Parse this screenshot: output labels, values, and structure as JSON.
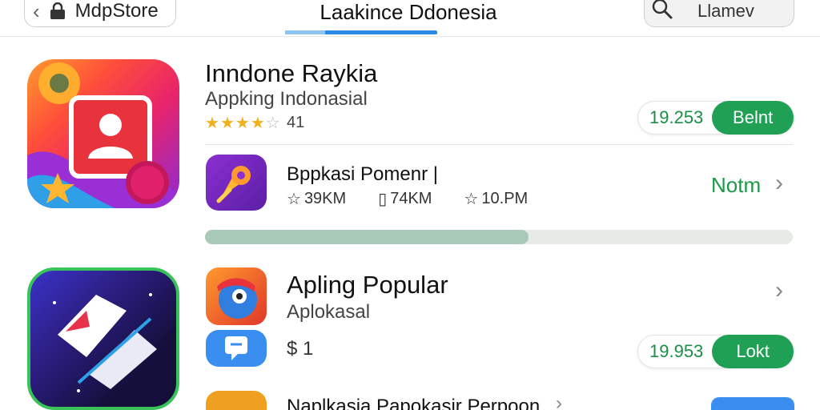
{
  "header": {
    "back_label": "MdpStore",
    "title": "Laakince Ddonesia",
    "search_placeholder": "Llamev"
  },
  "featured": {
    "title": "Inndone Raykia",
    "subtitle": "Appking Indonasial",
    "rating_stars": 4,
    "rating_count": "41",
    "price": "19.253",
    "action_label": "Belnt"
  },
  "row_item": {
    "title": "Bppkasi Pomenr |",
    "stat1": "39KM",
    "stat2": "74KM",
    "stat3": "10.PM",
    "link_label": "Notm"
  },
  "progress": {
    "fraction": 0.55
  },
  "popular": {
    "title": "Apling Popular",
    "subtitle": "Aplokasal",
    "price_tag": "$ 1",
    "price": "19.953",
    "action_label": "Lokt"
  },
  "bottom_row": {
    "title": "Naplkasia Papokasir Perpoon"
  },
  "colors": {
    "accent_green": "#1fa055",
    "tab_blue": "#2b8be6"
  }
}
